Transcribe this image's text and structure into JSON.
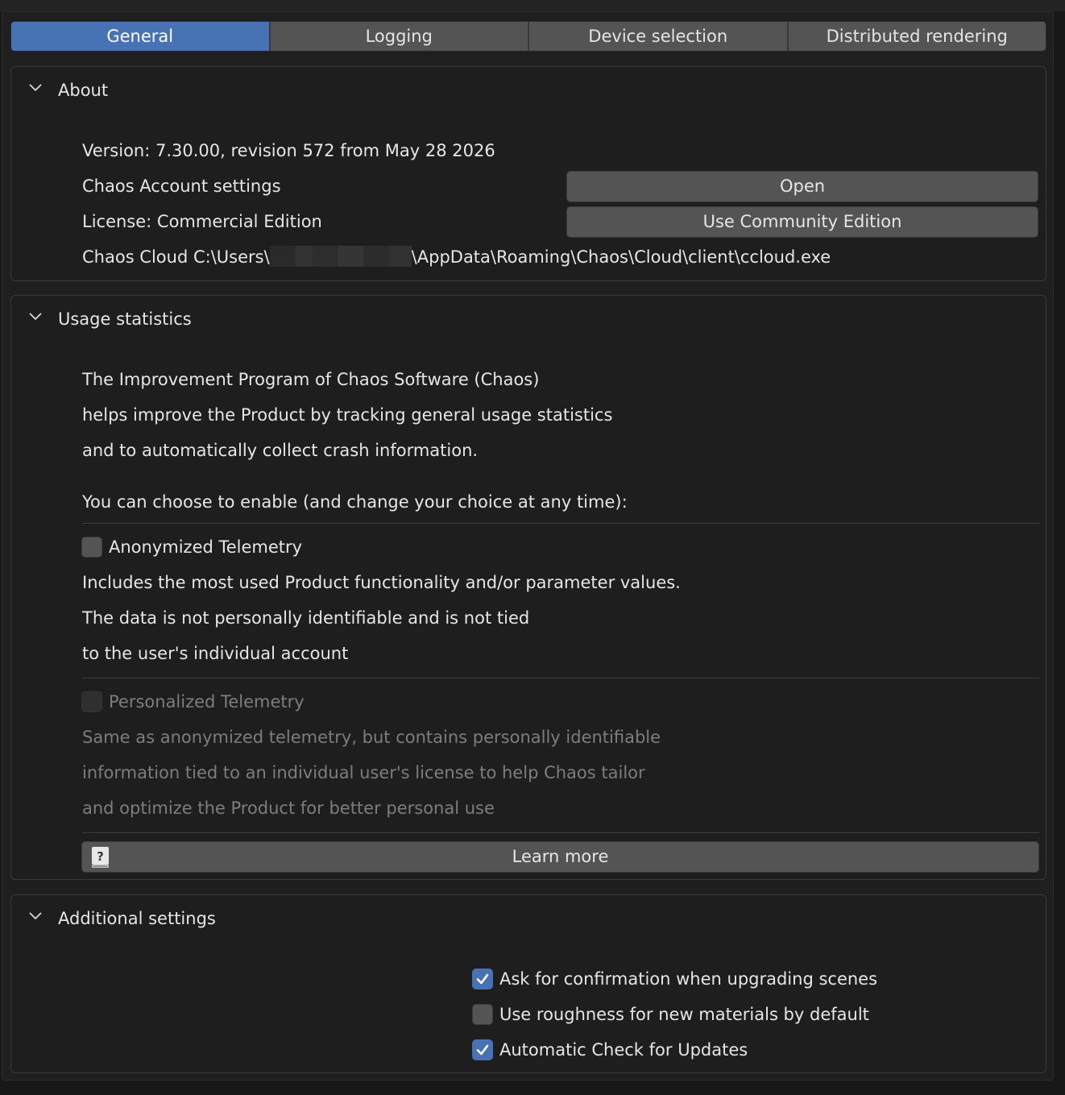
{
  "tabs": [
    {
      "label": "General",
      "active": true
    },
    {
      "label": "Logging",
      "active": false
    },
    {
      "label": "Device selection",
      "active": false
    },
    {
      "label": "Distributed rendering",
      "active": false
    }
  ],
  "about": {
    "title": "About",
    "version": "Version: 7.30.00, revision 572 from May 28 2026",
    "account_label": "Chaos Account settings",
    "open_button": "Open",
    "license_label": "License: Commercial Edition",
    "community_button": "Use Community Edition",
    "cloud_prefix": "Chaos Cloud C:\\Users\\",
    "cloud_suffix": "\\AppData\\Roaming\\Chaos\\Cloud\\client\\ccloud.exe"
  },
  "usage": {
    "title": "Usage statistics",
    "intro_1": "The Improvement Program of Chaos Software (Chaos)",
    "intro_2": "helps improve the Product by tracking general usage statistics",
    "intro_3": "and to automatically collect crash information.",
    "choose": "You can choose to enable (and change your choice at any time):",
    "anon_label": "Anonymized Telemetry",
    "anon_checked": false,
    "anon_desc_1": "Includes the most used Product functionality and/or parameter values.",
    "anon_desc_2": "The data is not personally identifiable and is not tied",
    "anon_desc_3": "to the user's individual account",
    "pers_label": "Personalized Telemetry",
    "pers_checked": false,
    "pers_desc_1": "Same as anonymized telemetry, but contains personally identifiable",
    "pers_desc_2": "information tied to an individual user's license to help Chaos tailor",
    "pers_desc_3": "and optimize the Product for better personal use",
    "learn_more": "Learn more"
  },
  "additional": {
    "title": "Additional settings",
    "options": [
      {
        "label": "Ask for confirmation when upgrading scenes",
        "checked": true
      },
      {
        "label": "Use roughness for new materials by default",
        "checked": false
      },
      {
        "label": "Automatic Check for Updates",
        "checked": true
      }
    ]
  },
  "colors": {
    "accent": "#4772b3",
    "button": "#545454",
    "background": "#1e1e1e"
  }
}
